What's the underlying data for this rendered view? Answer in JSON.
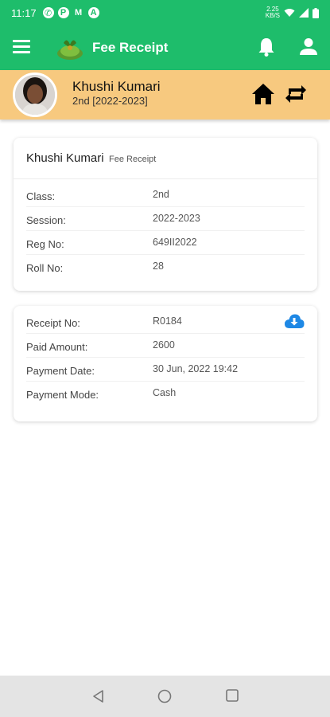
{
  "status_bar": {
    "time": "11:17",
    "net_speed_value": "2.25",
    "net_speed_unit": "KB/S",
    "icons": [
      "whatsapp-icon",
      "p-icon",
      "gmail-icon",
      "a-icon",
      "wifi-icon",
      "signal-icon",
      "battery-icon"
    ]
  },
  "app_bar": {
    "title": "Fee Receipt"
  },
  "profile": {
    "name": "Khushi Kumari",
    "class_session": "2nd [2022-2023]"
  },
  "student_card": {
    "name": "Khushi Kumari",
    "subtitle": "Fee Receipt",
    "rows": [
      {
        "label": "Class:",
        "value": "2nd"
      },
      {
        "label": "Session:",
        "value": "2022-2023"
      },
      {
        "label": "Reg No:",
        "value": "649II2022"
      },
      {
        "label": "Roll No:",
        "value": "28"
      }
    ]
  },
  "receipt_card": {
    "rows": [
      {
        "label": "Receipt No:",
        "value": "R0184"
      },
      {
        "label": "Paid Amount:",
        "value": "2600"
      },
      {
        "label": "Payment Date:",
        "value": "30 Jun, 2022 19:42"
      },
      {
        "label": "Payment Mode:",
        "value": "Cash"
      }
    ]
  },
  "colors": {
    "primary": "#1ebd6b",
    "profile_bar": "#f7c97f",
    "download_icon": "#1e88e5"
  }
}
